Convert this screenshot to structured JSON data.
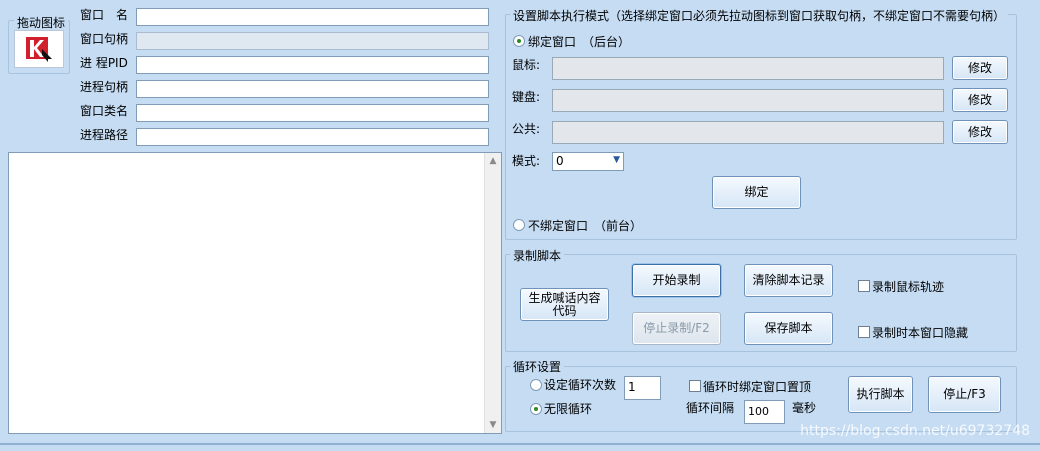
{
  "drag_icon": {
    "label": "拖动图标"
  },
  "window_info": {
    "window_name_label": "窗口　名",
    "window_handle_label": "窗口句柄",
    "process_pid_label": "进 程PID",
    "process_handle_label": "进程句柄",
    "window_class_label": "窗口类名",
    "process_path_label": "进程路径",
    "window_name_value": "",
    "window_handle_value": "",
    "process_pid_value": "",
    "process_handle_value": "",
    "window_class_value": "",
    "process_path_value": ""
  },
  "mode_group": {
    "title": "设置脚本执行模式（选择绑定窗口必须先拉动图标到窗口获取句柄，不绑定窗口不需要句柄）",
    "bind_label": "绑定窗口　（后台）",
    "mouse_label": "鼠标:",
    "keyboard_label": "键盘:",
    "common_label": "公共:",
    "modify_label": "修改",
    "mode_label": "模式:",
    "mode_value": "0",
    "bind_button": "绑定",
    "nobind_label": "不绑定窗口　（前台）"
  },
  "record_group": {
    "title": "录制脚本",
    "generate_button": "生成喊话内容代码",
    "start_button": "开始录制",
    "stop_button": "停止录制/F2",
    "clear_button": "清除脚本记录",
    "save_button": "保存脚本",
    "record_mouse_label": "录制鼠标轨迹",
    "hide_window_label": "录制时本窗口隐藏"
  },
  "loop_group": {
    "title": "循环设置",
    "set_count_label": "设定循环次数",
    "count_value": "1",
    "infinite_label": "无限循环",
    "topmost_label": "循环时绑定窗口置顶",
    "interval_label": "循环间隔",
    "interval_value": "100",
    "ms_label": "毫秒",
    "run_button": "执行脚本",
    "stop_button": "停止/F3"
  },
  "watermark": "https://blog.csdn.net/u69732748"
}
